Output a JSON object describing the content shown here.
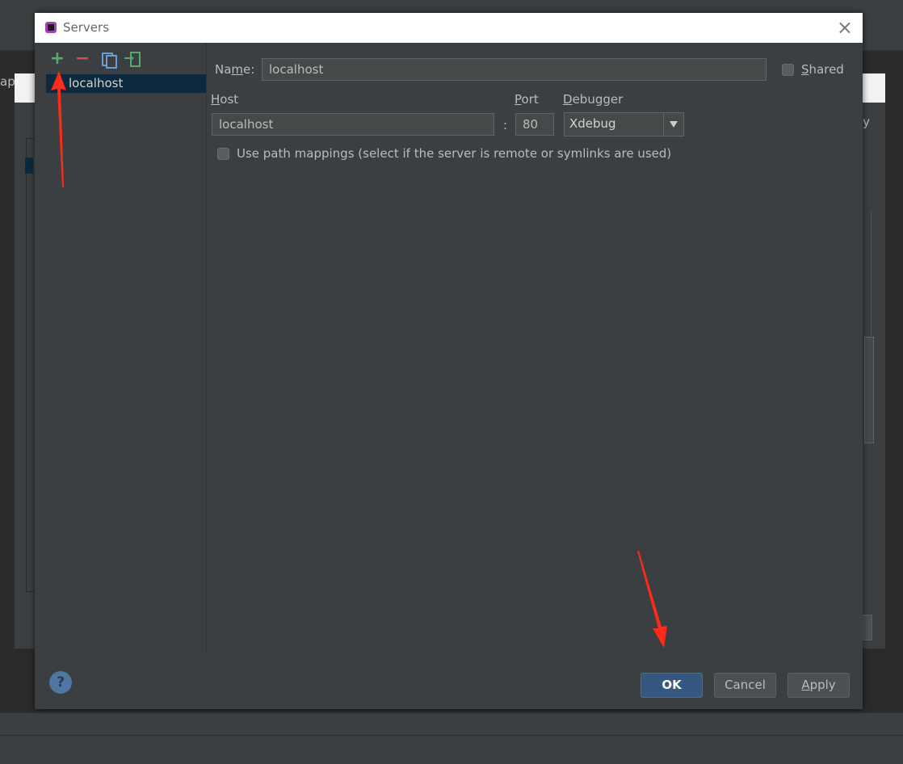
{
  "background": {
    "partial_text_left": "ap",
    "partial_text_right": "ly"
  },
  "dialog": {
    "title": "Servers",
    "toolbar": {
      "add": "+",
      "remove": "−"
    },
    "servers": [
      {
        "label": "localhost",
        "selected": true
      }
    ],
    "form": {
      "name_label_pre": "Na",
      "name_label_u": "m",
      "name_label_post": "e:",
      "name_value": "localhost",
      "shared_label_u": "S",
      "shared_label_rest": "hared",
      "host_label_u": "H",
      "host_label_rest": "ost",
      "host_value": "localhost",
      "port_separator": ":",
      "port_label_u": "P",
      "port_label_rest": "ort",
      "port_value": "80",
      "debugger_label_u": "D",
      "debugger_label_rest": "ebugger",
      "debugger_value": "Xdebug",
      "path_mappings_label": "Use path mappings (select if the server is remote or symlinks are used)"
    },
    "buttons": {
      "help": "?",
      "ok": "OK",
      "cancel": "Cancel",
      "apply_u": "A",
      "apply_rest": "pply"
    }
  },
  "colors": {
    "annotation": "#ff2a1a",
    "selection": "#0d293e",
    "ok_button": "#365880"
  }
}
